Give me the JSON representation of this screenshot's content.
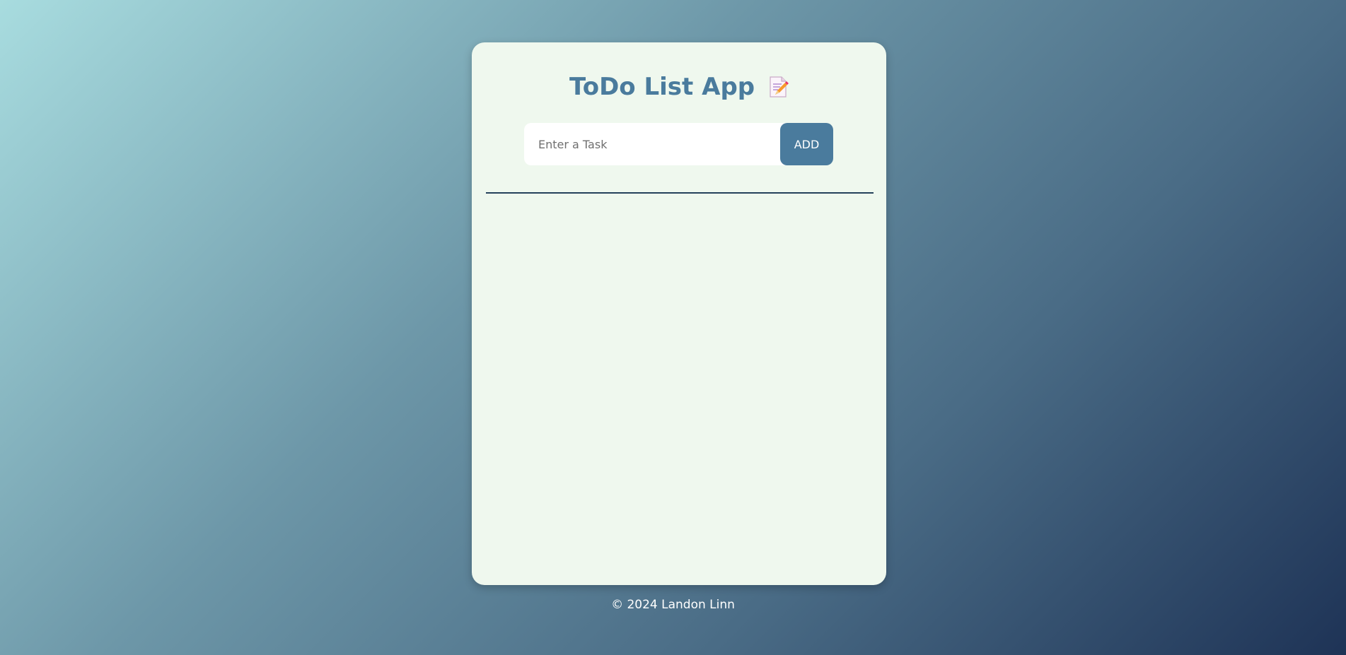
{
  "app": {
    "title": "ToDo List App",
    "title_icon": "memo-icon"
  },
  "form": {
    "placeholder": "Enter a Task",
    "value": "",
    "add_label": "ADD"
  },
  "tasks": [],
  "footer": {
    "text": "© 2024 Landon Linn"
  },
  "colors": {
    "accent": "#4a7b9d",
    "card_bg": "#eff8ee",
    "divider": "#24405a"
  }
}
